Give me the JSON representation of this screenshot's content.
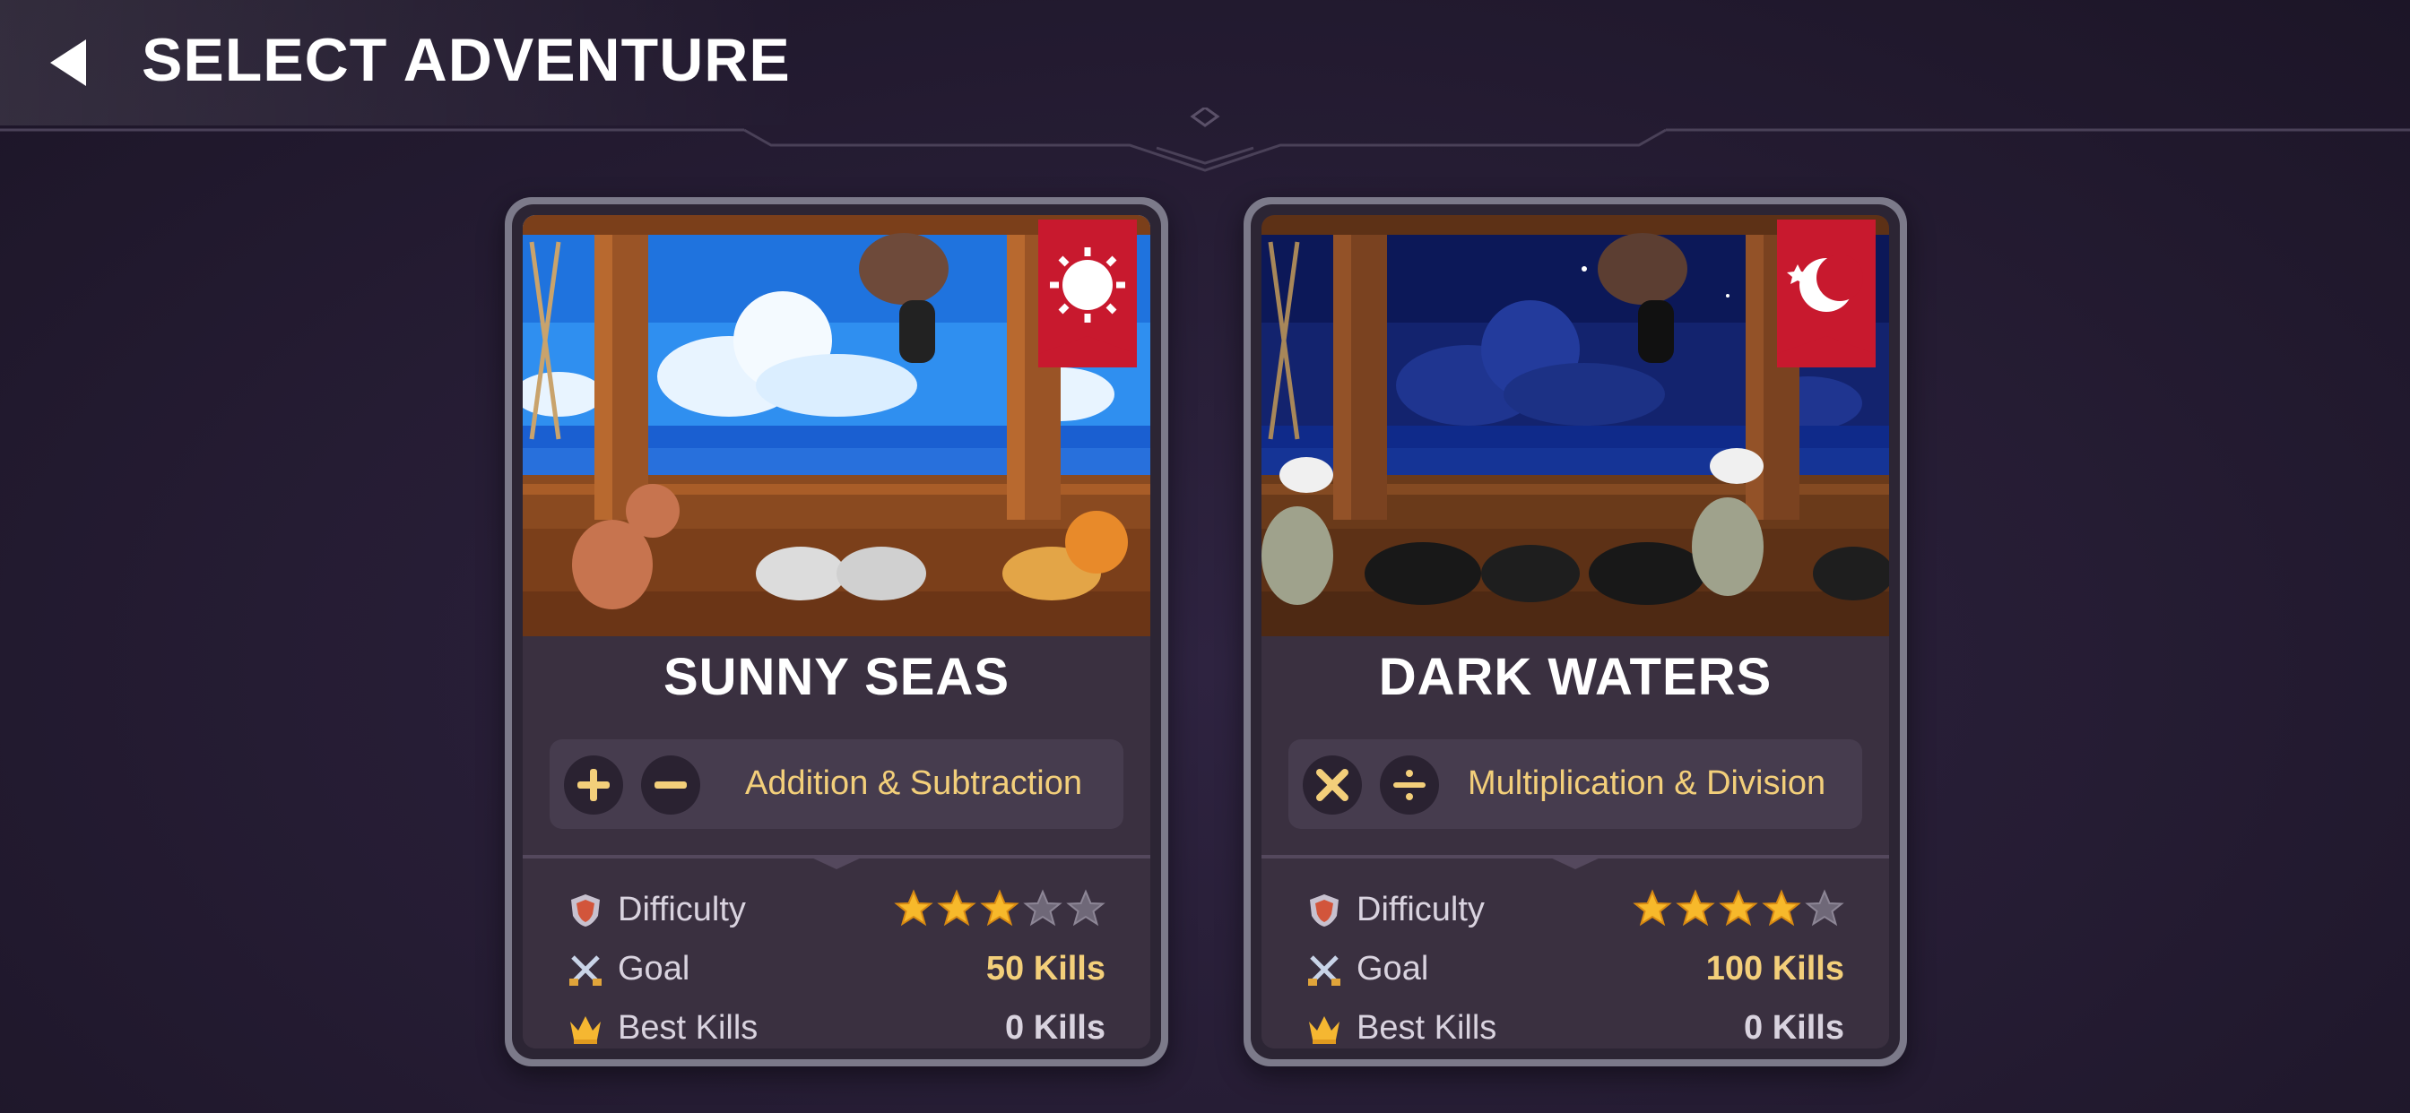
{
  "header": {
    "title": "SELECT ADVENTURE"
  },
  "cards": [
    {
      "title": "SUNNY SEAS",
      "banner_icon": "sun-icon",
      "ops": [
        "plus-icon",
        "minus-icon"
      ],
      "ops_label": "Addition & Subtraction",
      "difficulty_label": "Difficulty",
      "difficulty_stars": 3,
      "max_stars": 5,
      "goal_label": "Goal",
      "goal_value": "50 Kills",
      "best_label": "Best Kills",
      "best_value": "0 Kills"
    },
    {
      "title": "DARK WATERS",
      "banner_icon": "moon-icon",
      "ops": [
        "multiply-icon",
        "divide-icon"
      ],
      "ops_label": "Multiplication & Division",
      "difficulty_label": "Difficulty",
      "difficulty_stars": 4,
      "max_stars": 5,
      "goal_label": "Goal",
      "goal_value": "100 Kills",
      "best_label": "Best Kills",
      "best_value": "0 Kills"
    }
  ],
  "colors": {
    "accent_gold": "#f3cf7a",
    "banner_red": "#c8192e",
    "day_sky": "#2f8ff0",
    "night_sky": "#13236e"
  }
}
